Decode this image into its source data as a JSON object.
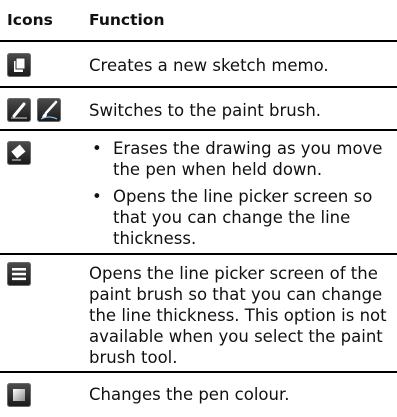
{
  "table": {
    "headers": {
      "icons": "Icons",
      "function": "Function"
    },
    "rows": [
      {
        "icons": [
          "new-sketch-memo-icon"
        ],
        "description": "Creates a new sketch memo."
      },
      {
        "icons": [
          "pen-icon",
          "paint-brush-icon"
        ],
        "description": "Switches to the paint brush."
      },
      {
        "icons": [
          "eraser-icon"
        ],
        "bullets": [
          "Erases the drawing as you move the pen when held down.",
          "Opens the line picker screen so that you can change the line thickness."
        ]
      },
      {
        "icons": [
          "line-thickness-icon"
        ],
        "description": "Opens the line picker screen of the paint brush so that you can change the line thickness. This option is not available when you select the paint brush tool."
      },
      {
        "icons": [
          "pen-colour-icon"
        ],
        "description": "Changes the pen colour."
      }
    ]
  }
}
